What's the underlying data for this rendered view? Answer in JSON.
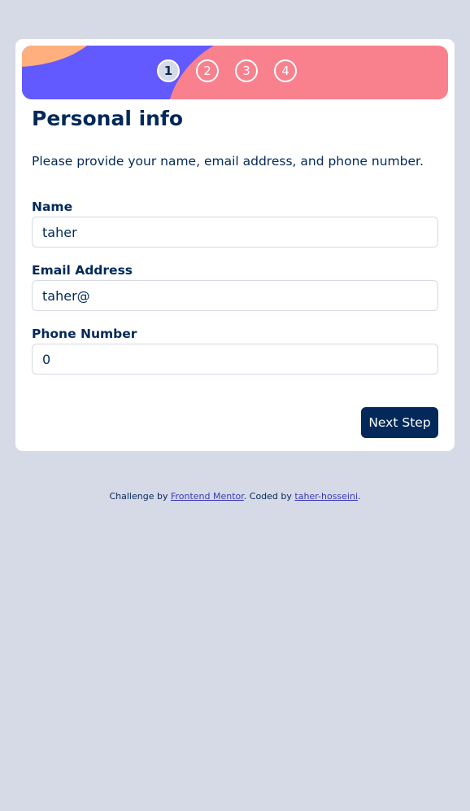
{
  "steps": [
    "1",
    "2",
    "3",
    "4"
  ],
  "active_step": "1",
  "page": {
    "title": "Personal info",
    "description": "Please provide your name, email address, and phone number."
  },
  "form": {
    "name_label": "Name",
    "name_value": "taher",
    "email_label": "Email Address",
    "email_value": "taher@",
    "phone_label": "Phone Number",
    "phone_value": "0"
  },
  "actions": {
    "next_label": "Next Step"
  },
  "footer": {
    "prefix": "Challenge by",
    "link1": "Frontend Mentor",
    "middle": ". Coded by",
    "link2": "taher-hosseini",
    "suffix": "."
  },
  "colors": {
    "background": "#d6d9e6",
    "denim": "#02295a",
    "purple": "#6259ff",
    "pink": "#f9818e",
    "orange": "#ffaf7e"
  }
}
